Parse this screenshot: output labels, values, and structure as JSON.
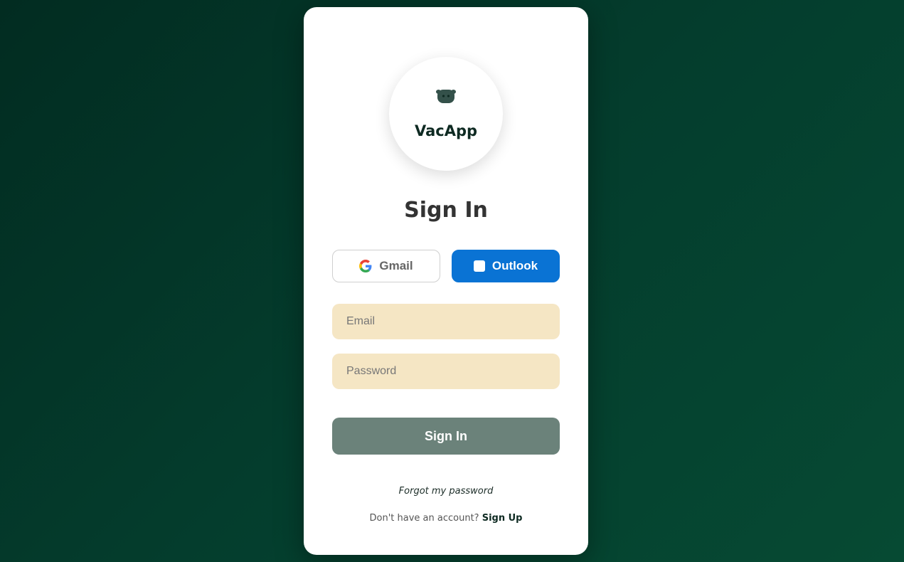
{
  "brand": {
    "name": "VacApp",
    "icon": "cow-head-icon"
  },
  "form": {
    "title": "Sign In",
    "email_placeholder": "Email",
    "password_placeholder": "Password",
    "submit_label": "Sign In"
  },
  "oauth": {
    "gmail_label": "Gmail",
    "gmail_icon": "google-icon",
    "outlook_label": "Outlook",
    "outlook_icon": "outlook-icon"
  },
  "links": {
    "forgot_password": "Forgot my password",
    "no_account_text": "Don't have an account?",
    "signup_label": "Sign Up"
  },
  "colors": {
    "background": "#043d2d",
    "outlook_blue": "#0a73d4",
    "input_bg": "#f5e6c4",
    "submit_bg": "#6b827a",
    "brand_text": "#0e2a22"
  }
}
